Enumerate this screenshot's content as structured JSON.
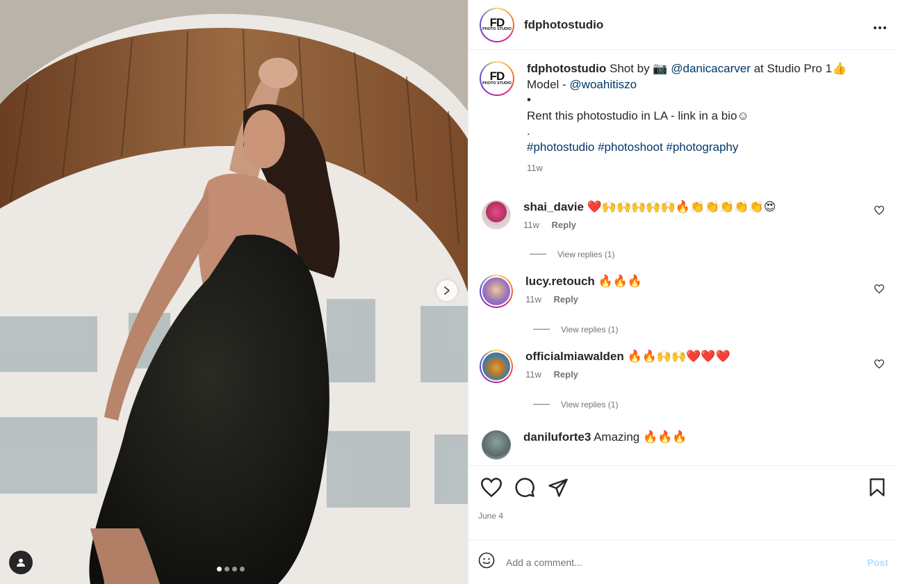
{
  "post": {
    "username": "fdphotostudio",
    "logo_text": "FD",
    "logo_subtext": "PHOTO STUDIO"
  },
  "caption": {
    "username": "fdphotostudio",
    "text_1": "Shot by 📷",
    "mention_1": "@danicacarver",
    "text_2": "at Studio Pro 1👍",
    "text_3": "Model -",
    "mention_2": "@woahitiszo",
    "bullet": "•",
    "text_4": "Rent this photostudio in LA - link in a bio☺",
    "dot": ".",
    "hashtags": "#photostudio #photoshoot #photography",
    "time": "11w"
  },
  "comments": [
    {
      "username": "shai_davie",
      "text": "❤️🙌🙌🙌🙌🙌🔥👏👏👏👏👏😍",
      "time": "11w",
      "reply": "Reply",
      "view_replies": "View replies (1)"
    },
    {
      "username": "lucy.retouch",
      "text": "🔥🔥🔥",
      "time": "11w",
      "reply": "Reply",
      "view_replies": "View replies (1)"
    },
    {
      "username": "officialmiawalden",
      "text": "🔥🔥🙌🙌❤️❤️❤️",
      "time": "11w",
      "reply": "Reply",
      "view_replies": "View replies (1)"
    },
    {
      "username": "daniluforte3",
      "text": "Amazing 🔥🔥🔥"
    }
  ],
  "footer": {
    "date": "June 4",
    "add_comment_placeholder": "Add a comment...",
    "post_label": "Post"
  },
  "icons": {
    "more": "more-horizontal-icon",
    "like": "heart-icon",
    "comment": "comment-icon",
    "share": "share-icon",
    "save": "bookmark-icon",
    "emoji": "emoji-icon",
    "next": "chevron-right-icon",
    "tag": "user-tag-icon"
  },
  "carousel": {
    "count": 4,
    "active": 0
  }
}
